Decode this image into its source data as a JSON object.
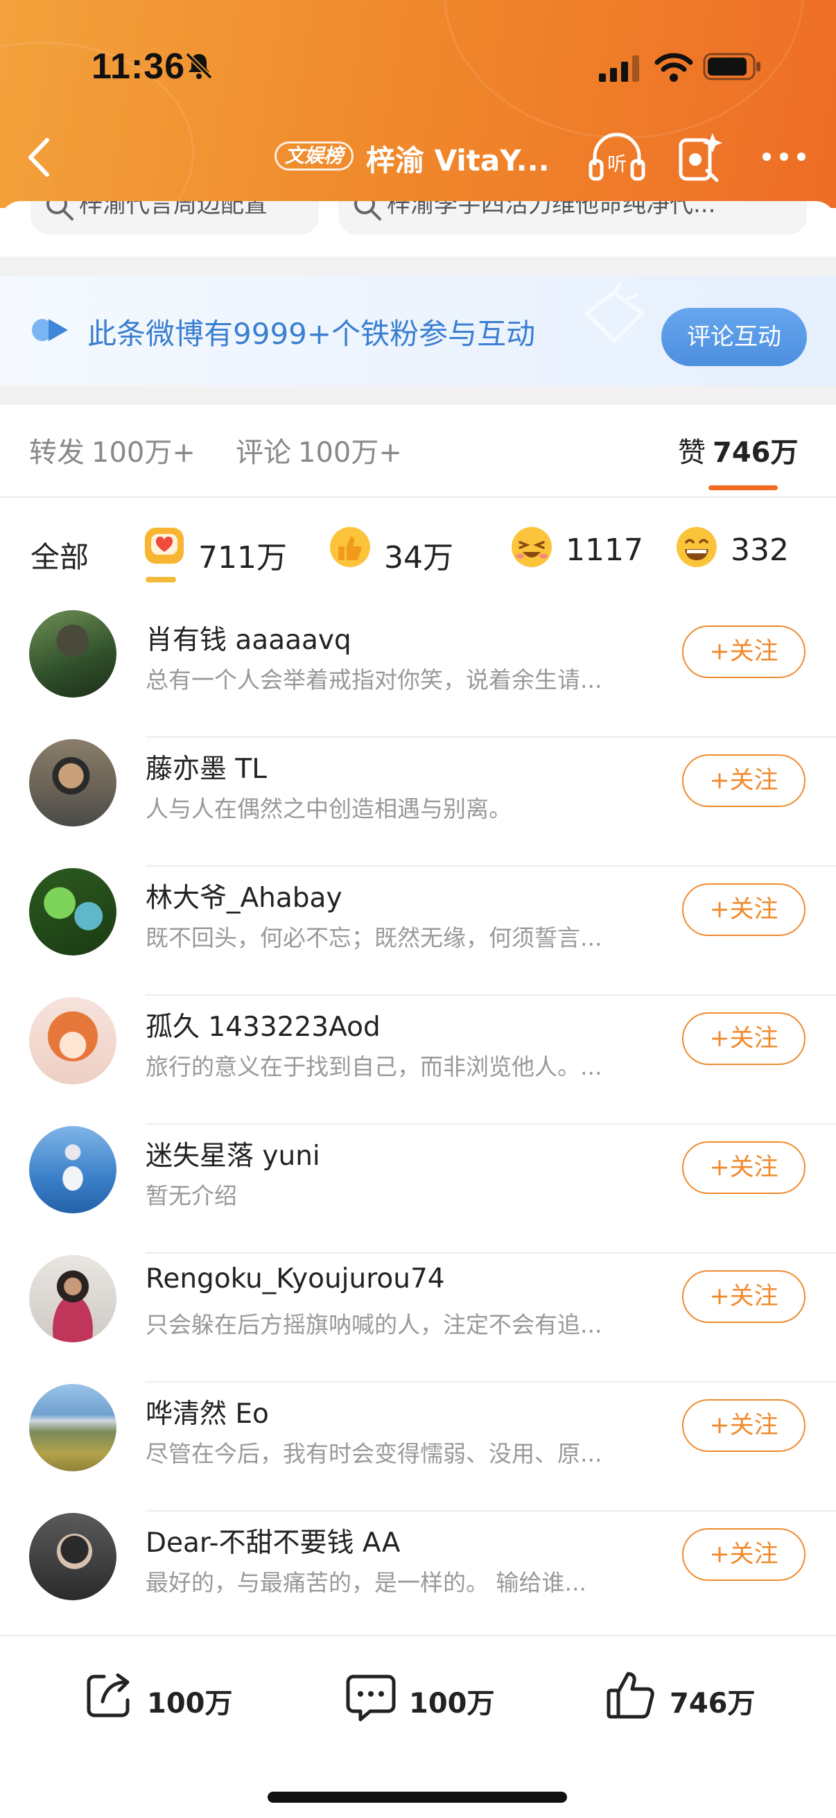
{
  "status_bar": {
    "time": "11:36"
  },
  "nav": {
    "tag": "文娱榜",
    "title": "梓渝 VitaY..."
  },
  "search_chips": [
    {
      "text": "梓渝代言周边配置"
    },
    {
      "text": "梓渝李宇四活力维他命纯净代..."
    }
  ],
  "fans_banner": {
    "text": "此条微博有9999+个铁粉参与互动",
    "button": "评论互动"
  },
  "tabs": [
    {
      "label": "转发",
      "count": "100万+"
    },
    {
      "label": "评论",
      "count": "100万+"
    },
    {
      "label": "赞",
      "count": "746万"
    }
  ],
  "reactions": {
    "all_label": "全部",
    "items": [
      {
        "icon": "heart-face-icon",
        "count": "711万"
      },
      {
        "icon": "thumbs-up-icon",
        "count": "34万"
      },
      {
        "icon": "laughing-face-icon",
        "count": "1117"
      },
      {
        "icon": "grinning-face-icon",
        "count": "332"
      }
    ]
  },
  "follow_label": "+关注",
  "users": [
    {
      "name": "肖有钱 aaaaavq",
      "bio": "总有一个人会举着戒指对你笑，说着余生请..."
    },
    {
      "name": "藤亦墨 TL",
      "bio": "人与人在偶然之中创造相遇与别离。"
    },
    {
      "name": "林大爷_Ahabay",
      "bio": "既不回头，何必不忘；既然无缘，何须誓言..."
    },
    {
      "name": "孤久 1433223Aod",
      "bio": "旅行的意义在于找到自己，而非浏览他人。..."
    },
    {
      "name": "迷失星落 yuni",
      "bio": "暂无介绍"
    },
    {
      "name": "Rengoku_Kyoujurou74",
      "bio": "只会躲在后方摇旗呐喊的人，注定不会有追..."
    },
    {
      "name": "哗清然 Eo",
      "bio": "尽管在今后，我有时会变得懦弱、没用、原..."
    },
    {
      "name": "Dear-不甜不要钱 AA",
      "bio": "最好的，与最痛苦的，是一样的。 输给谁..."
    }
  ],
  "bottom_bar": {
    "repost": "100万",
    "comment": "100万",
    "like": "746万"
  },
  "colors": {
    "header_orange": "#f08a2c",
    "accent_orange": "#f26b22",
    "link_blue": "#3b7fd1"
  }
}
